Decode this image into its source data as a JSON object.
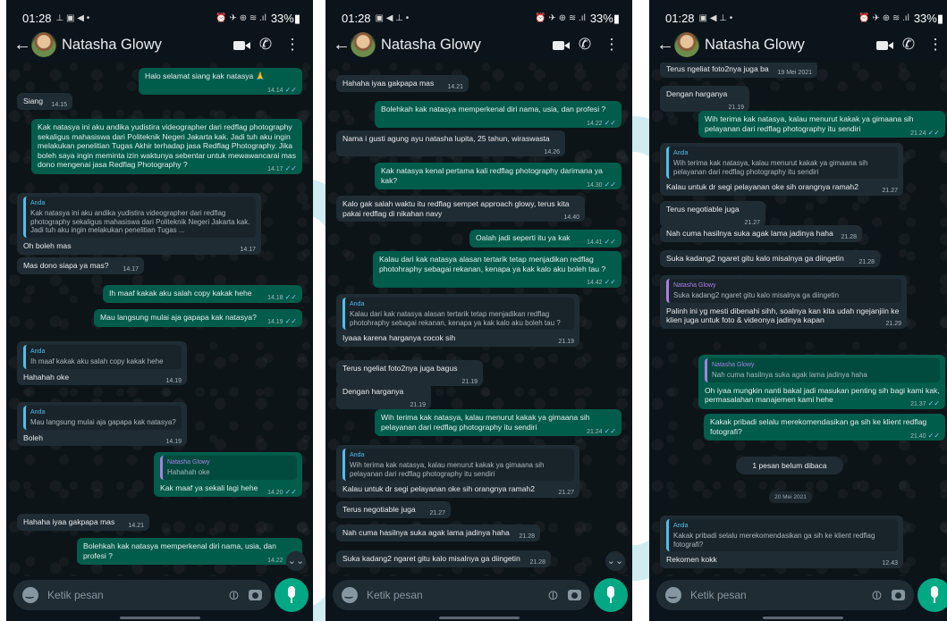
{
  "phones": [
    {
      "status": {
        "time": "01:28",
        "left_icons": "⊥ ▣ ◀ •",
        "right_icons": "⏰ ✈ ⊕ ≋ .ıl",
        "battery": "33%▮"
      },
      "header": {
        "contact_name": "Natasha Glowy"
      },
      "input": {
        "placeholder": "Ketik pesan"
      },
      "messages": [
        {
          "dir": "out",
          "text": "Halo selamat siang kak natasya 🙏",
          "time": "14.14",
          "ticks": true
        },
        {
          "dir": "in",
          "text": "Siang",
          "time": "14.15"
        },
        {
          "dir": "out",
          "text": "Kak natasya ini aku andika yudistira videographer dari redflag photography sekaligus mahasiswa dari Politeknik Negeri Jakarta kak. Jadi tuh aku ingin melakukan penelitian Tugas Akhir terhadap jasa Redflag Photography. Jika boleh saya ingin meminta izin waktunya sebentar untuk mewawancarai mas dono mengenai jasa Redflag Photography ?",
          "time": "14.17",
          "ticks": true
        },
        {
          "dir": "in",
          "quote_name": "Anda",
          "quote": "Kak natasya ini aku andika yudistira videographer dari redflag photography sekaligus mahasiswa dari Politeknik Negeri Jakarta kak. Jadi tuh aku ingin melakukan penelitian Tugas ...",
          "text": "Oh boleh mas",
          "time": "14.17"
        },
        {
          "dir": "in",
          "text": "Mas dono siapa ya mas?",
          "time": "14.17"
        },
        {
          "dir": "out",
          "text": "Ih maaf kakak aku salah copy kakak hehe",
          "time": "14.18",
          "ticks": true
        },
        {
          "dir": "out",
          "text": "Mau langsung mulai aja gapapa kak natasya?",
          "time": "14.19",
          "ticks": true
        },
        {
          "dir": "in",
          "quote_name": "Anda",
          "quote": "Ih maaf kakak aku salah copy kakak hehe",
          "text": "Hahahah oke",
          "time": "14.19"
        },
        {
          "dir": "in",
          "quote_name": "Anda",
          "quote": "Mau langsung mulai aja gapapa kak natasya?",
          "text": "Boleh",
          "time": "14.19"
        },
        {
          "dir": "out",
          "quote_name": "Natasha Glowy",
          "quote": "Hahahah oke",
          "text": "Kak maaf ya sekali lagi hehe",
          "time": "14.20",
          "ticks": true
        },
        {
          "dir": "in",
          "text": "Hahaha iyaa gakpapa mas",
          "time": "14.21"
        },
        {
          "dir": "out",
          "text": "Bolehkah kak natasya memperkenal diri  nama, usia, dan profesi ?",
          "time": "14.22",
          "ticks": true
        }
      ],
      "scroll_icon": "⌄⌄"
    },
    {
      "status": {
        "time": "01:28",
        "left_icons": "▣ ◀ ⊥ •",
        "right_icons": "⏰ ✈ ⊕ ≋ .ıl",
        "battery": "33%▮"
      },
      "header": {
        "contact_name": "Natasha Glowy"
      },
      "input": {
        "placeholder": "Ketik pesan"
      },
      "messages": [
        {
          "dir": "in",
          "text": "Hahaha iyaa gakpapa mas",
          "time": "14.21"
        },
        {
          "dir": "out",
          "text": "Bolehkah kak natasya memperkenal diri  nama, usia, dan profesi ?",
          "time": "14.22",
          "ticks": true
        },
        {
          "dir": "in",
          "text": "Nama i gusti agung ayu natasha lupita, 25 tahun, wiraswasta",
          "time": "14.26"
        },
        {
          "dir": "out",
          "text": "Kak natasya kenal pertama kali redflag photography darimana ya kak?",
          "time": "14.30",
          "ticks": true
        },
        {
          "dir": "in",
          "text": "Kalo gak salah waktu itu redflag sempet approach glowy, terus kita pakai redflag di nikahan navy",
          "time": "14.40"
        },
        {
          "dir": "out",
          "text": "Oalah jadi seperti itu ya kak",
          "time": "14.41",
          "ticks": true
        },
        {
          "dir": "out",
          "text": "Kalau dari kak natasya alasan tertarik tetap menjadikan redflag photohraphy sebagai rekanan, kenapa ya kak kalo aku boleh tau ?",
          "time": "14.42",
          "ticks": true
        },
        {
          "dir": "in",
          "quote_name": "Anda",
          "quote": "Kalau dari kak natasya alasan tertarik tetap menjadikan redflag photohraphy sebagai rekanan, kenapa ya kak kalo aku boleh tau ?",
          "text": "Iyaaa karena harganya cocok sih",
          "time": "21.19"
        },
        {
          "dir": "in",
          "text": "Terus ngeliat foto2nya juga bagus",
          "time": "21.19"
        },
        {
          "dir": "in",
          "text": "Dengan harganya",
          "time": "21.19"
        },
        {
          "dir": "out",
          "text": "Wih terima kak natasya, kalau menurut kakak ya gimaana sih pelayanan dari redflag photography itu sendiri",
          "time": "21.24",
          "ticks": true
        },
        {
          "dir": "in",
          "quote_name": "Anda",
          "quote": "Wih terima kak natasya, kalau menurut kakak ya gimaana sih pelayanan dari redflag photography itu sendiri",
          "text": "Kalau untuk dr segi pelayanan oke sih orangnya ramah2",
          "time": "21.27"
        },
        {
          "dir": "in",
          "text": "Terus negotiable juga",
          "time": "21.27"
        },
        {
          "dir": "in",
          "text": "Nah cuma hasilnya suka agak lama jadinya haha",
          "time": "21.28"
        },
        {
          "dir": "in",
          "text": "Suka kadang2 ngaret gitu kalo misalnya ga diingetin",
          "time": "21.28"
        }
      ],
      "scroll_icon": "⌄⌄"
    },
    {
      "status": {
        "time": "01:28",
        "left_icons": "▣ ◀ ⊥ •",
        "right_icons": "⏰ ✈ ⊕ ≋ .ıl",
        "battery": "33%▮"
      },
      "header": {
        "contact_name": "Natasha Glowy"
      },
      "input": {
        "placeholder": "Ketik pesan"
      },
      "messages": [
        {
          "dir": "in",
          "text": "Terus ngeliat foto2nya juga ba",
          "time": "19 Mei 2021"
        },
        {
          "dir": "in",
          "text": "Dengan harganya",
          "time": "21.19"
        },
        {
          "dir": "out",
          "text": "Wih terima kak natasya, kalau menurut kakak ya gimaana sih pelayanan dari redflag photography itu sendiri",
          "time": "21.24",
          "ticks": true
        },
        {
          "dir": "in",
          "quote_name": "Anda",
          "quote": "Wih terima kak natasya, kalau menurut kakak ya gimaana sih pelayanan dari redflag photography itu sendiri",
          "text": "Kalau untuk dr segi pelayanan oke sih orangnya ramah2",
          "time": "21.27"
        },
        {
          "dir": "in",
          "text": "Terus negotiable juga",
          "time": "21.27"
        },
        {
          "dir": "in",
          "text": "Nah cuma hasilnya suka agak lama jadinya haha",
          "time": "21.28"
        },
        {
          "dir": "in",
          "text": "Suka kadang2 ngaret gitu kalo misalnya ga diingetin",
          "time": "21.28"
        },
        {
          "dir": "in",
          "quote_name": "Natasha Glowy",
          "quote": "Suka kadang2 ngaret gitu kalo misalnya ga diingetin",
          "text": "Palinh ini yg mesti dibenahi sihh, soalnya kan kita udah ngejanjiin ke klien juga untuk foto & videonya jadinya kapan",
          "time": "21.29"
        },
        {
          "dir": "out",
          "quote_name": "Natasha Glowy",
          "quote": "Nah cuma hasilnya suka agak lama jadinya haha",
          "text": "Oh iyaa mungkin nanti bakal jadi masukan penting sih bagi kami kak, permasalahan manajemen kami hehe",
          "time": "21.37",
          "ticks": true
        },
        {
          "dir": "out",
          "text": "Kakak pribadi selalu merekomendasikan ga sih ke klient redflag fotografi?",
          "time": "21.40",
          "ticks": true
        },
        {
          "dir": "in",
          "quote_name": "Anda",
          "quote": "Kakak pribadi selalu merekomendasikan ga sih ke klient redflag fotografi?",
          "text": "Rekomen kokk",
          "time": "12.43"
        }
      ],
      "unread_pill": "1 pesan belum dibaca",
      "date_pill": "20 Mei 2021"
    }
  ]
}
